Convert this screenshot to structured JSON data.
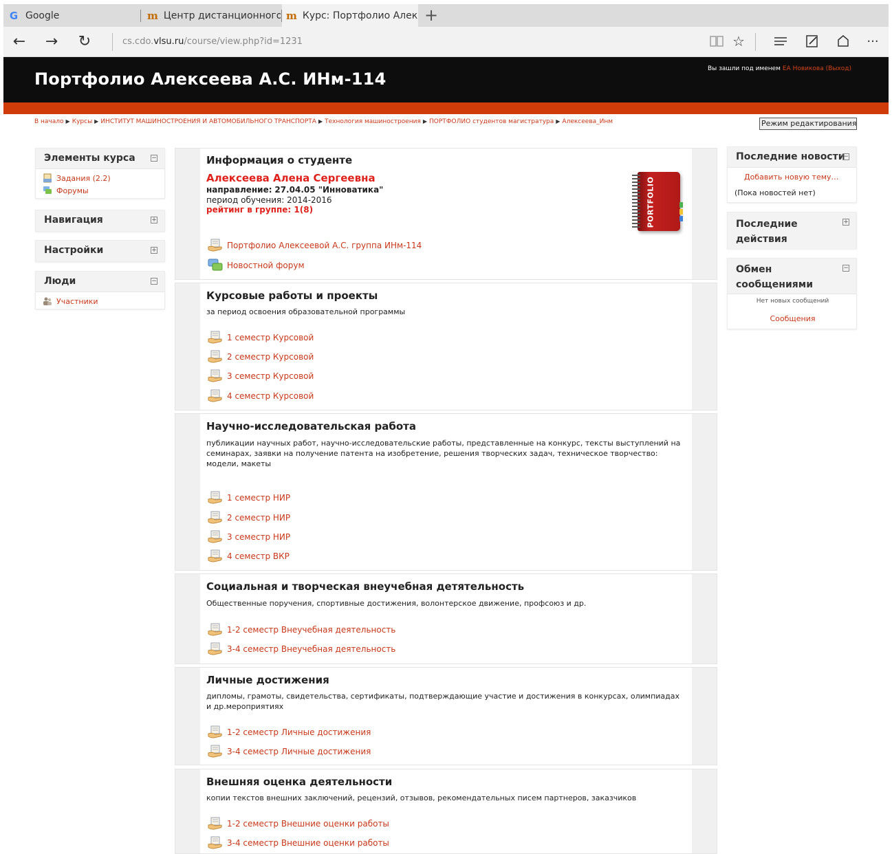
{
  "browser": {
    "tabs": [
      {
        "label": "Google",
        "icon": "google-icon"
      },
      {
        "label": "Центр дистанционного об",
        "icon": "moodle-icon"
      },
      {
        "label": "Курс: Портфолио Алек",
        "icon": "moodle-icon"
      }
    ],
    "url_prefix": "cs.cdo.",
    "url_domain": "vlsu.ru",
    "url_path": "/course/view.php?id=1231"
  },
  "header": {
    "title": "Портфолио Алексеева А.С. ИНм-114",
    "login_prefix": "Вы зашли под именем",
    "login_user": "ЕА Новикова",
    "logout": "(Выход)"
  },
  "breadcrumb": [
    "В начало",
    "Курсы",
    "ИНСТИТУТ МАШИНОСТРОЕНИЯ И АВТОМОБИЛЬНОГО ТРАНСПОРТА",
    "Технология машиностроения",
    "ПОРТФОЛИО студентов магистратура",
    "Алексеева_Инм"
  ],
  "edit_button": "Режим редактирования",
  "left_blocks": {
    "course_elements": {
      "title": "Элементы курса",
      "items": [
        "Задания (2.2)",
        "Форумы"
      ]
    },
    "navigation": {
      "title": "Навигация"
    },
    "settings": {
      "title": "Настройки"
    },
    "people": {
      "title": "Люди",
      "items": [
        "Участники"
      ]
    }
  },
  "right_blocks": {
    "news": {
      "title": "Последние новости",
      "add_topic": "Добавить новую тему…",
      "empty": "(Пока новостей нет)"
    },
    "recent": {
      "title_line1": "Последние",
      "title_line2": "действия"
    },
    "messages": {
      "title_line1": "Обмен",
      "title_line2": "сообщениями",
      "empty": "Нет новых сообщений",
      "link": "Сообщения"
    }
  },
  "student": {
    "section_title": "Информация о студенте",
    "name": "Алексеева Алена Сергеевна",
    "direction_label": "направление:",
    "direction_value": "27.04.05 \"Инноватика\"",
    "period_label": "период обучения:",
    "period_value": "2014-2016",
    "rating": "рейтинг в группе: 1(8)",
    "book_label": "PORTFOLIO",
    "links": [
      "Портфолио Алексеевой А.С. группа ИНм-114",
      "Новостной форум"
    ]
  },
  "sections": {
    "course": {
      "title": "Курсовые работы и проекты",
      "desc": "за период освоения образовательной программы",
      "items": [
        "1 семестр Курсовой",
        "2 семестр Курсовой",
        "3 семестр Курсовой",
        "4 семестр Курсовой"
      ]
    },
    "research": {
      "title": "Научно-исследовательская работа",
      "desc": "публикации научных работ, научно-исследовательские работы, представленные на конкурс, тексты выступлений на семинарах, заявки на получение патента на изобретение, решения творческих задач, техническое творчество: модели, макеты",
      "items": [
        "1 семестр НИР",
        "2 семестр НИР",
        "3 семестр НИР",
        "4 семестр ВКР"
      ]
    },
    "social": {
      "title": "Социальная и творческая внеучебная детятельность",
      "desc": "Общественные поручения, спортивные достижения, волонтерское движение, профсоюз и др.",
      "items": [
        "1-2 семестр Внеучебная деятельность",
        "3-4 семестр Внеучебная деятельность"
      ]
    },
    "personal": {
      "title": "Личные достижения",
      "desc": "дипломы, грамоты, свидетельства, сертификаты, подтверждающие участие и достижения в конкурсах, олимпиадах и др.мероприятиях",
      "items": [
        "1-2 семестр Личные достижения",
        "3-4 семестр Личные достижения"
      ]
    },
    "external": {
      "title": "Внешняя оценка деятельности",
      "desc": "копии текстов внешних заключений, рецензий, отзывов, рекомендательных писем партнеров, заказчиков",
      "items": [
        "1-2 семестр Внешние оценки работы",
        "3-4 семестр Внешние оценки работы"
      ]
    }
  },
  "colors": {
    "link": "#c9381a",
    "accent_band": "#cf3c0a",
    "header_bg": "#0d0d0d",
    "student_name": "#e0221c"
  }
}
